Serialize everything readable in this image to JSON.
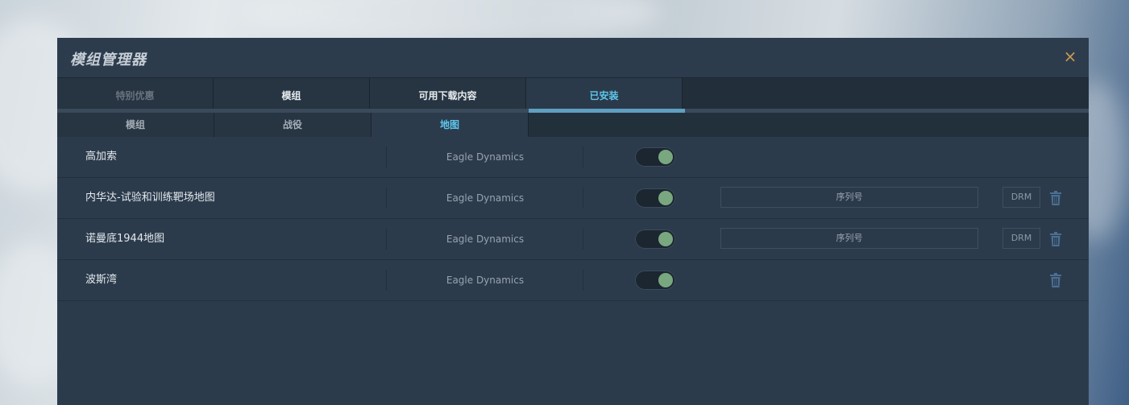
{
  "window": {
    "title": "模组管理器",
    "close_glyph": "×"
  },
  "tabs": [
    {
      "label": "特别优惠",
      "state": "muted"
    },
    {
      "label": "模组",
      "state": "normal"
    },
    {
      "label": "可用下载内容",
      "state": "normal"
    },
    {
      "label": "已安装",
      "state": "active"
    }
  ],
  "subtabs": [
    {
      "label": "模组",
      "state": "normal"
    },
    {
      "label": "战役",
      "state": "normal"
    },
    {
      "label": "地图",
      "state": "active"
    }
  ],
  "rows": [
    {
      "name": "高加索",
      "author": "Eagle Dynamics",
      "enabled": true
    },
    {
      "name": "内华达-试验和训练靶场地图",
      "author": "Eagle Dynamics",
      "enabled": true,
      "serial_placeholder": "序列号",
      "drm_label": "DRM"
    },
    {
      "name": "诺曼底1944地图",
      "author": "Eagle Dynamics",
      "enabled": true,
      "serial_placeholder": "序列号",
      "drm_label": "DRM"
    },
    {
      "name": "波斯湾",
      "author": "Eagle Dynamics",
      "enabled": true
    }
  ],
  "colors": {
    "accent": "#5ec6ec",
    "toggle_on": "#79a77f",
    "close": "#c89a52",
    "panel": "#2c3b4c"
  },
  "icons": {
    "close": "close-icon",
    "delete": "trash-icon"
  }
}
